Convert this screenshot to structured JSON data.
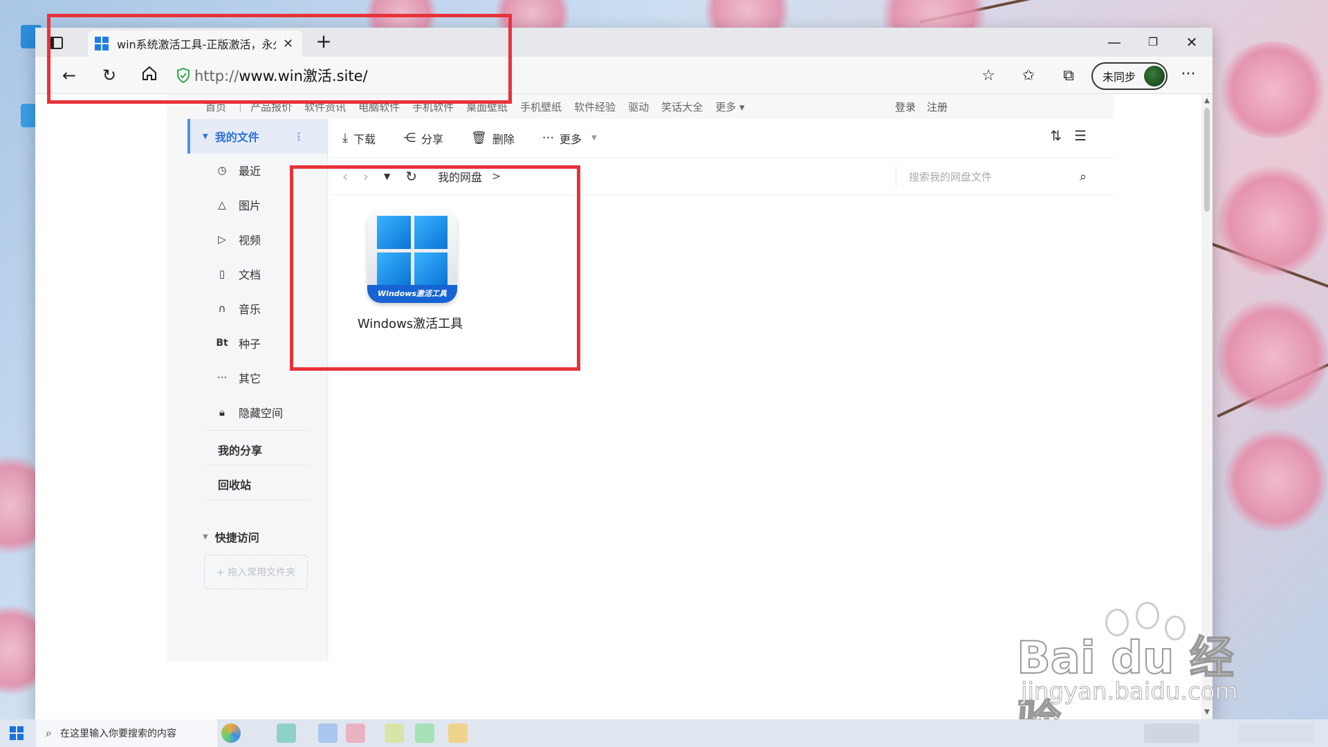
{
  "browser": {
    "tab_title": "win系统激活工具-正版激活，永久",
    "url_protocol": "http://",
    "url_rest": "www.win激活.site/",
    "sync_label": "未同步"
  },
  "site_nav": {
    "items": [
      "首页",
      "产品报价",
      "软件资讯",
      "电脑软件",
      "手机软件",
      "桌面壁纸",
      "手机壁纸",
      "软件经验",
      "驱动",
      "笑话大全",
      "更多 ▾"
    ],
    "login": "登录",
    "register": "注册"
  },
  "sidebar": {
    "my_files": "我的文件",
    "items": [
      {
        "icon": "clock-icon",
        "label": "最近"
      },
      {
        "icon": "image-icon",
        "label": "图片"
      },
      {
        "icon": "play-icon",
        "label": "视频"
      },
      {
        "icon": "document-icon",
        "label": "文档"
      },
      {
        "icon": "headphones-icon",
        "label": "音乐"
      },
      {
        "icon": "bt-icon",
        "label": "种子"
      },
      {
        "icon": "ellipsis-icon",
        "label": "其它"
      },
      {
        "icon": "lock-icon",
        "label": "隐藏空间"
      }
    ],
    "my_share": "我的分享",
    "recycle": "回收站",
    "quick_access": "快捷访问",
    "drop_hint": "+ 拖入常用文件夹"
  },
  "toolbar": {
    "download": "下载",
    "share": "分享",
    "delete": "删除",
    "more": "更多"
  },
  "pathbar": {
    "crumb": "我的网盘",
    "search_placeholder": "搜索我的网盘文件"
  },
  "file": {
    "name": "Windows激活工具",
    "icon_caption": "Windows激活工具"
  },
  "taskbar": {
    "search_placeholder": "在这里输入你要搜索的内容"
  },
  "watermark": {
    "brand": "Bai du 经验",
    "domain": "jingyan.baidu.com"
  },
  "colors": {
    "annotation": "#e8323a",
    "accent": "#2f6fd6"
  }
}
